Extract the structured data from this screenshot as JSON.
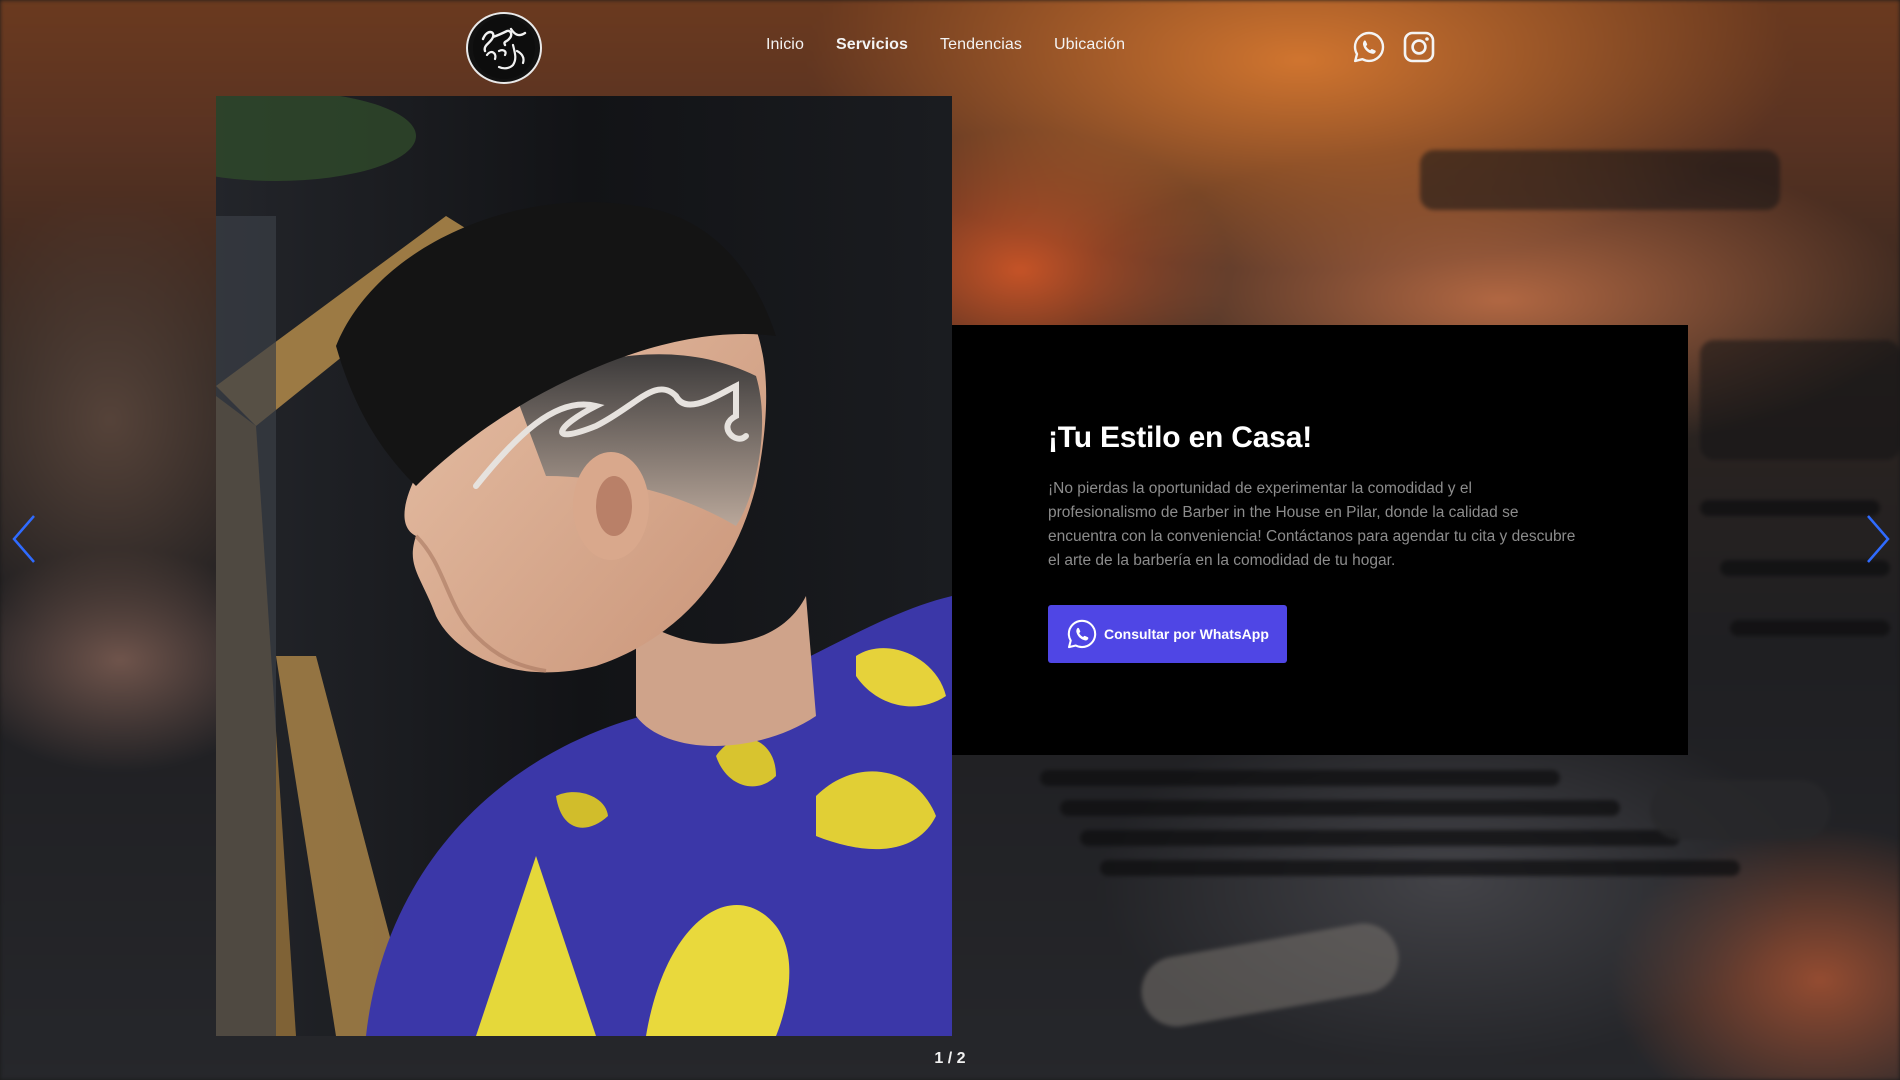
{
  "brand": {
    "logo_icon": "barber-in-the-house-logo"
  },
  "nav": {
    "items": [
      {
        "label": "Inicio",
        "active": false
      },
      {
        "label": "Servicios",
        "active": true
      },
      {
        "label": "Tendencias",
        "active": false
      },
      {
        "label": "Ubicación",
        "active": false
      }
    ]
  },
  "social": {
    "icons": [
      "whatsapp-icon",
      "instagram-icon"
    ]
  },
  "slide": {
    "title": "¡Tu Estilo en Casa!",
    "description": "¡No pierdas la oportunidad de experimentar la comodidad y el profesionalismo de Barber in the House en Pilar, donde la calidad se encuentra con la conveniencia! Contáctanos para agendar tu cita y descubre el arte de la barbería en la comodidad de tu hogar.",
    "cta_label": "Consultar por WhatsApp",
    "cta_icon": "whatsapp-icon",
    "image": "haircut-with-design-photo"
  },
  "carousel": {
    "pagination": "1 / 2",
    "prev_icon": "chevron-left-icon",
    "next_icon": "chevron-right-icon"
  },
  "colors": {
    "accent": "#4f46e5",
    "card": "#000000",
    "arrows": "#2f6bff"
  }
}
